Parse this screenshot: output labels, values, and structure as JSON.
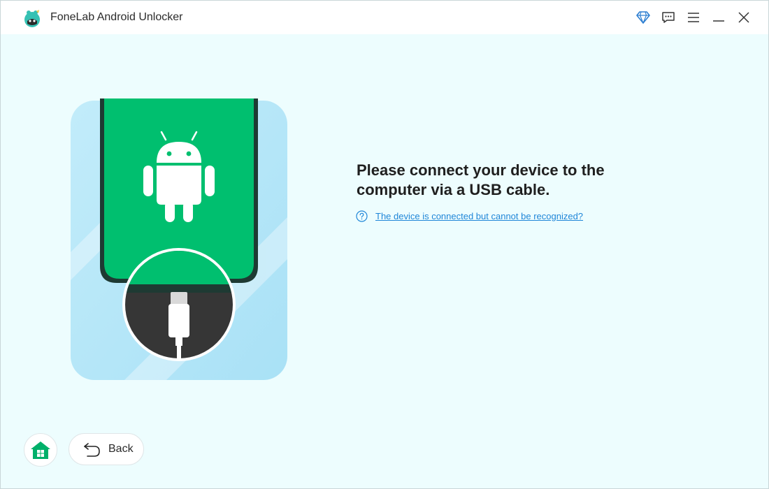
{
  "app": {
    "title": "FoneLab Android Unlocker"
  },
  "titlebar": {
    "icons": [
      "diamond-icon",
      "feedback-icon",
      "menu-icon",
      "minimize-icon",
      "close-icon"
    ]
  },
  "main": {
    "headline": "Please connect your device to the computer via a USB cable.",
    "help_link": "The device is connected but cannot be recognized?"
  },
  "footer": {
    "home_icon": "home-icon",
    "back_label": "Back"
  },
  "colors": {
    "accent_green": "#00bf6f",
    "link_blue": "#1f86d8",
    "background": "#edfdfe"
  }
}
